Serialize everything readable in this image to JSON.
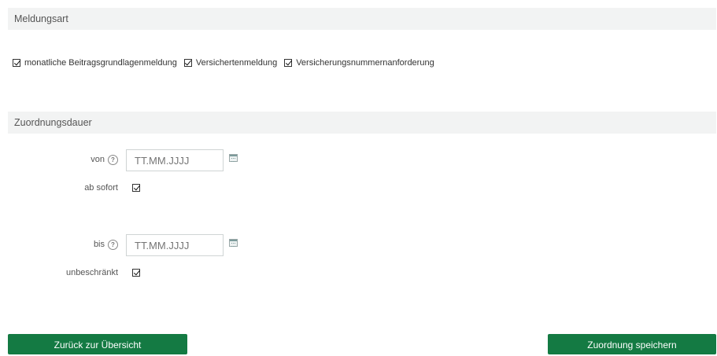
{
  "meldungsart": {
    "title": "Meldungsart",
    "options": [
      {
        "label": "monatliche Beitragsgrundlagenmeldung",
        "checked": true
      },
      {
        "label": "Versichertenmeldung",
        "checked": true
      },
      {
        "label": "Versicherungsnummernanforderung",
        "checked": true
      }
    ]
  },
  "zuordnungsdauer": {
    "title": "Zuordnungsdauer",
    "von": {
      "label": "von",
      "help": "?",
      "placeholder": "TT.MM.JJJJ",
      "value": ""
    },
    "ab_sofort": {
      "label": "ab sofort",
      "checked": true
    },
    "bis": {
      "label": "bis",
      "help": "?",
      "placeholder": "TT.MM.JJJJ",
      "value": ""
    },
    "unbeschraenkt": {
      "label": "unbeschränkt",
      "checked": true
    }
  },
  "buttons": {
    "back": "Zurück zur Übersicht",
    "save": "Zuordnung speichern"
  },
  "colors": {
    "button_green": "#147a43",
    "section_header_bg": "#f2f3f3"
  }
}
